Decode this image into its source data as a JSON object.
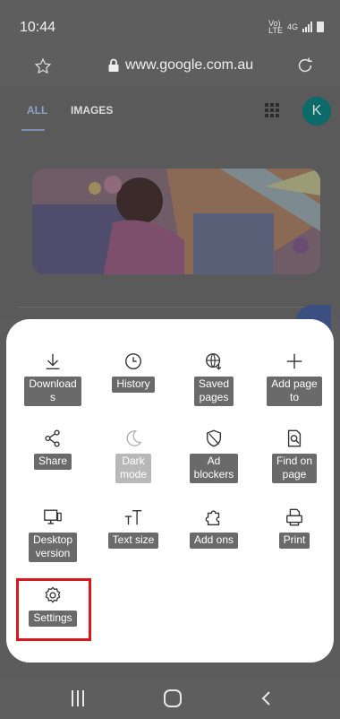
{
  "status_bar": {
    "time": "10:44",
    "signal_text_1": "Vo)",
    "signal_text_2": "LTE",
    "network": "4G"
  },
  "url_bar": {
    "url": "www.google.com.au"
  },
  "page": {
    "tabs": [
      "ALL",
      "IMAGES"
    ],
    "avatar_letter": "K"
  },
  "menu": {
    "items": [
      {
        "label": "Download\ns",
        "icon": "download-icon",
        "enabled": true
      },
      {
        "label": "History",
        "icon": "history-clock-icon",
        "enabled": true
      },
      {
        "label": "Saved\npages",
        "icon": "saved-pages-globe-icon",
        "enabled": true
      },
      {
        "label": "Add page\nto",
        "icon": "plus-icon",
        "enabled": true
      },
      {
        "label": "Share",
        "icon": "share-icon",
        "enabled": true
      },
      {
        "label": "Dark\nmode",
        "icon": "moon-icon",
        "enabled": false
      },
      {
        "label": "Ad\nblockers",
        "icon": "shield-icon",
        "enabled": true
      },
      {
        "label": "Find on\npage",
        "icon": "find-on-page-icon",
        "enabled": true
      },
      {
        "label": "Desktop\nversion",
        "icon": "desktop-icon",
        "enabled": true
      },
      {
        "label": "Text size",
        "icon": "text-size-icon",
        "enabled": true
      },
      {
        "label": "Add ons",
        "icon": "add-ons-puzzle-icon",
        "enabled": true
      },
      {
        "label": "Print",
        "icon": "print-icon",
        "enabled": true
      },
      {
        "label": "Settings",
        "icon": "gear-icon",
        "enabled": true
      }
    ]
  },
  "colors": {
    "highlight": "#d9181e",
    "label_bg": "#6a6a6a",
    "label_disabled_bg": "#b8b8b8"
  }
}
